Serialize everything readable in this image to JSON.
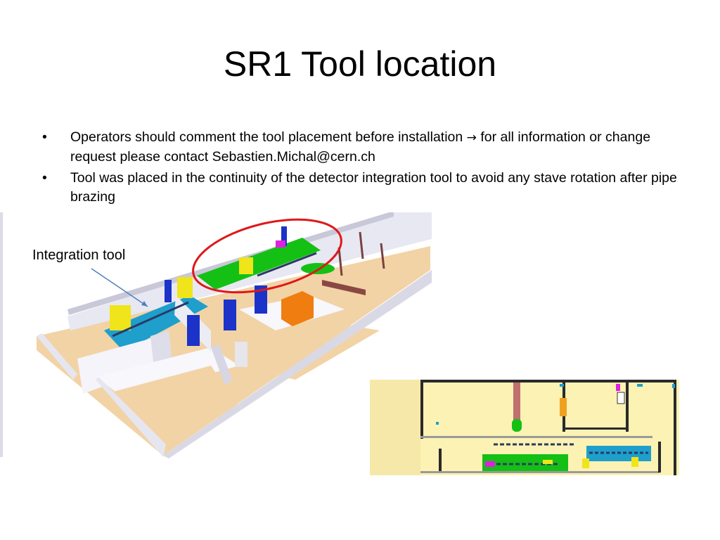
{
  "slide": {
    "title": "SR1 Tool location",
    "bullets": [
      {
        "before_arrow": "Operators should comment the tool placement before installation ",
        "arrow_symbol": "→",
        "after_arrow": " for all information or change request please contact Sebastien.Michal@cern.ch"
      },
      {
        "text": "Tool was placed in the continuity of the detector integration tool to avoid any stave rotation after pipe brazing"
      }
    ],
    "bullet_symbol": "•",
    "annotation_label": "Integration tool"
  },
  "colors": {
    "highlight_ellipse": "#e0181a",
    "pointer_arrow": "#4f81bd",
    "floor": "#f2d3a6",
    "wall": "#eeeef4",
    "green_area": "#15c015",
    "cyan_area": "#1e9fcc",
    "yellow_box": "#f0e41a",
    "orange_box": "#f07d10",
    "blue_door": "#1b33c8",
    "maroon_strip": "#8a4844",
    "plan_floor": "#fcf2b4"
  }
}
